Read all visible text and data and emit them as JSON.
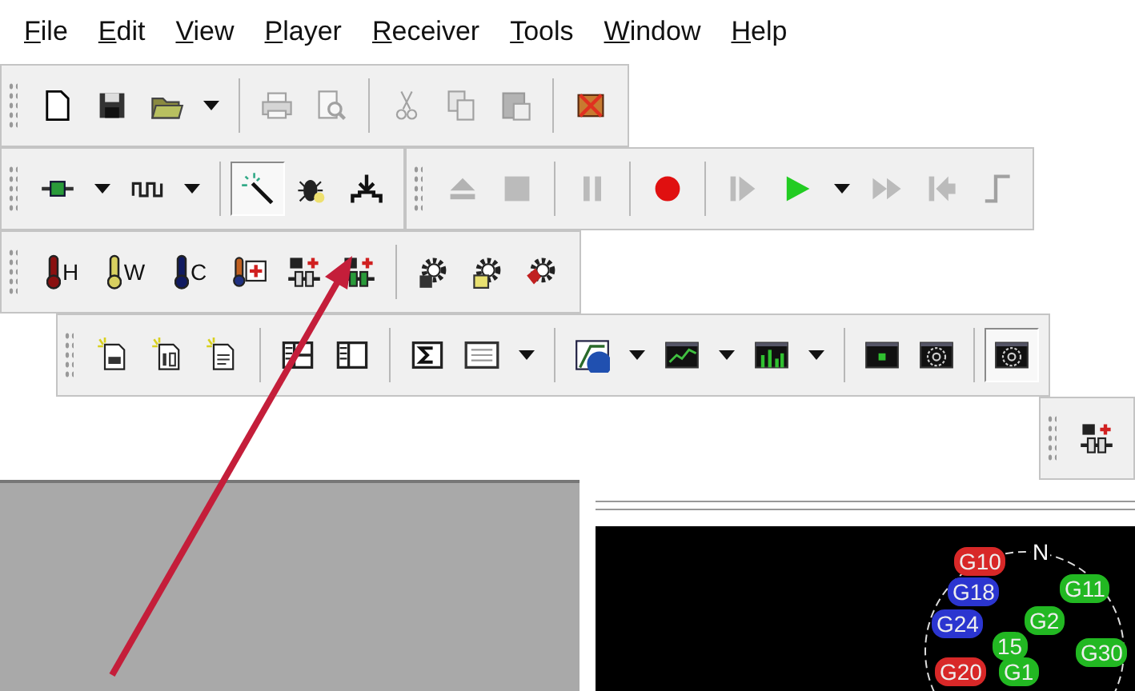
{
  "menu": [
    {
      "label": "File"
    },
    {
      "label": "Edit"
    },
    {
      "label": "View"
    },
    {
      "label": "Player"
    },
    {
      "label": "Receiver"
    },
    {
      "label": "Tools"
    },
    {
      "label": "Window"
    },
    {
      "label": "Help"
    }
  ],
  "toolbar_rows": [
    {
      "kind": "start",
      "toolbars": [
        {
          "groups": [
            [
              {
                "kind": "new",
                "disabled": false,
                "pressed": false
              },
              {
                "kind": "save",
                "disabled": false,
                "pressed": false
              },
              {
                "kind": "open",
                "disabled": false,
                "pressed": false,
                "dropdown": true
              }
            ],
            [
              {
                "kind": "print",
                "disabled": true,
                "pressed": false
              },
              {
                "kind": "preview",
                "disabled": true,
                "pressed": false
              }
            ],
            [
              {
                "kind": "cut",
                "disabled": true,
                "pressed": false
              },
              {
                "kind": "copy",
                "disabled": true,
                "pressed": false
              },
              {
                "kind": "paste",
                "disabled": true,
                "pressed": false
              }
            ],
            [
              {
                "kind": "xbox",
                "disabled": false,
                "pressed": false
              }
            ]
          ]
        }
      ]
    },
    {
      "kind": "start",
      "toolbars": [
        {
          "groups": [
            [
              {
                "kind": "connector",
                "disabled": false,
                "pressed": false,
                "dropdown": true
              },
              {
                "kind": "wave",
                "disabled": false,
                "pressed": false,
                "dropdown": true
              }
            ],
            [
              {
                "kind": "wand",
                "disabled": false,
                "pressed": true
              },
              {
                "kind": "bug",
                "disabled": false,
                "pressed": false
              },
              {
                "kind": "download",
                "disabled": false,
                "pressed": false
              }
            ]
          ]
        },
        {
          "groups": [
            [
              {
                "kind": "eject",
                "disabled": true,
                "pressed": false
              },
              {
                "kind": "stop",
                "disabled": true,
                "pressed": false
              }
            ],
            [
              {
                "kind": "pause",
                "disabled": true,
                "pressed": false
              }
            ],
            [
              {
                "kind": "record",
                "disabled": false,
                "pressed": false
              }
            ],
            [
              {
                "kind": "step",
                "disabled": true,
                "pressed": false
              },
              {
                "kind": "play",
                "disabled": false,
                "pressed": false,
                "dropdown": true
              },
              {
                "kind": "ffwd",
                "disabled": true,
                "pressed": false
              },
              {
                "kind": "skipback",
                "disabled": true,
                "pressed": false
              },
              {
                "kind": "bracket",
                "disabled": true,
                "pressed": false
              }
            ]
          ]
        }
      ]
    },
    {
      "kind": "start",
      "toolbars": [
        {
          "groups": [
            [
              {
                "kind": "therm_hot",
                "label": "H",
                "disabled": false,
                "pressed": false
              },
              {
                "kind": "therm_warm",
                "label": "W",
                "disabled": false,
                "pressed": false
              },
              {
                "kind": "therm_cold",
                "label": "C",
                "disabled": false,
                "pressed": false
              },
              {
                "kind": "therm_plus",
                "disabled": false,
                "pressed": false
              },
              {
                "kind": "mod_grey",
                "disabled": false,
                "pressed": false
              },
              {
                "kind": "mod_green",
                "disabled": false,
                "pressed": false
              }
            ],
            [
              {
                "kind": "gear_disk",
                "disabled": false,
                "pressed": false
              },
              {
                "kind": "gear_folder",
                "disabled": false,
                "pressed": false
              },
              {
                "kind": "gear_red",
                "disabled": false,
                "pressed": false
              }
            ]
          ]
        }
      ]
    },
    {
      "kind": "indent",
      "toolbars": [
        {
          "groups": [
            [
              {
                "kind": "doc_print",
                "disabled": false,
                "pressed": false
              },
              {
                "kind": "doc_binary",
                "disabled": false,
                "pressed": false
              },
              {
                "kind": "doc_text",
                "disabled": false,
                "pressed": false
              }
            ],
            [
              {
                "kind": "layout_split",
                "disabled": false,
                "pressed": false
              },
              {
                "kind": "layout_side",
                "disabled": false,
                "pressed": false
              }
            ],
            [
              {
                "kind": "sigma",
                "disabled": false,
                "pressed": false
              },
              {
                "kind": "table",
                "disabled": false,
                "pressed": false,
                "dropdown": true
              }
            ],
            [
              {
                "kind": "chart_globe",
                "disabled": false,
                "pressed": false,
                "dropdown": true
              },
              {
                "kind": "chart_line",
                "disabled": false,
                "pressed": false,
                "dropdown": true
              },
              {
                "kind": "chart_bar",
                "disabled": false,
                "pressed": false,
                "dropdown": true
              }
            ],
            [
              {
                "kind": "screen",
                "disabled": false,
                "pressed": false
              },
              {
                "kind": "sky",
                "disabled": false,
                "pressed": false
              }
            ],
            [
              {
                "kind": "sky",
                "disabled": false,
                "pressed": true
              }
            ]
          ]
        }
      ]
    },
    {
      "kind": "end",
      "toolbars": [
        {
          "groups": [
            [
              {
                "kind": "mod_plus",
                "disabled": false,
                "pressed": false
              }
            ]
          ]
        }
      ]
    }
  ],
  "sky_plot": {
    "direction_labels": [
      {
        "text": "N"
      }
    ],
    "satellites": [
      {
        "id": "G10",
        "color": "#d82828"
      },
      {
        "id": "G18",
        "color": "#2b35d0"
      },
      {
        "id": "G11",
        "color": "#22b822"
      },
      {
        "id": "G24",
        "color": "#2b35d0"
      },
      {
        "id": "G2",
        "color": "#22b822"
      },
      {
        "id": "15",
        "color": "#22b822"
      },
      {
        "id": "G30",
        "color": "#22b822"
      },
      {
        "id": "G20",
        "color": "#d82828"
      },
      {
        "id": "G1",
        "color": "#22b822"
      }
    ]
  }
}
